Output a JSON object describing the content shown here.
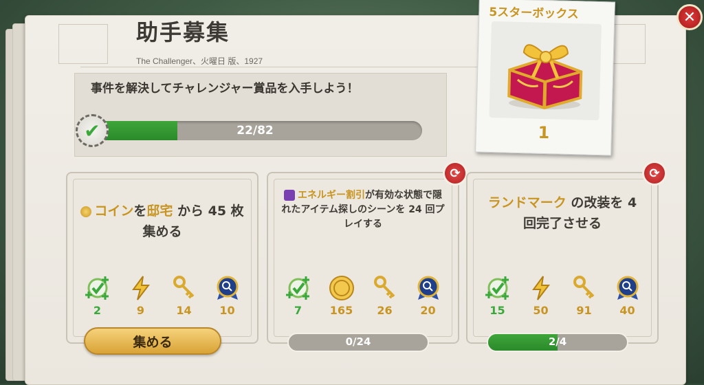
{
  "header": {
    "title": "助手募集",
    "subtitle": "The Challenger、火曜日 版、1927"
  },
  "main_goal": {
    "text": "事件を解決してチャレンジャー賞品を入手しよう！",
    "progress_label": "22/82",
    "current": 22,
    "total": 82
  },
  "reward": {
    "title": "5スターボックス",
    "count": "1"
  },
  "tasks": [
    {
      "segments": [
        {
          "text": "コイン",
          "hl": true
        },
        {
          "text": "を",
          "hl": false
        },
        {
          "text": "邸宅",
          "hl": true
        },
        {
          "text": " から 45 枚集める",
          "hl": false
        }
      ],
      "rewards": [
        {
          "icon": "check-plus-icon",
          "value": "2"
        },
        {
          "icon": "energy-icon",
          "value": "9"
        },
        {
          "icon": "key-icon",
          "value": "14"
        },
        {
          "icon": "magnifier-medal-icon",
          "value": "10"
        }
      ],
      "button_label": "集める"
    },
    {
      "segments": [
        {
          "text": "エネルギー割引",
          "hl": true
        },
        {
          "text": "が有効な状態で隠れたアイテム探しのシーンを 24 回プレイする",
          "hl": false
        }
      ],
      "rewards": [
        {
          "icon": "check-plus-icon",
          "value": "7"
        },
        {
          "icon": "coin-icon",
          "value": "165"
        },
        {
          "icon": "key-icon",
          "value": "26"
        },
        {
          "icon": "magnifier-medal-icon",
          "value": "20"
        }
      ],
      "progress_label": "0/24",
      "progress": 0.0
    },
    {
      "segments": [
        {
          "text": "ランドマーク",
          "hl": true
        },
        {
          "text": " の改装を 4 回完了させる",
          "hl": false
        }
      ],
      "rewards": [
        {
          "icon": "check-plus-icon",
          "value": "15"
        },
        {
          "icon": "energy-icon",
          "value": "50"
        },
        {
          "icon": "key-icon",
          "value": "91"
        },
        {
          "icon": "magnifier-medal-icon",
          "value": "40"
        }
      ],
      "progress_label": "2/4",
      "progress": 0.5
    }
  ],
  "colors": {
    "gold": "#c89422",
    "green": "#3aa83a",
    "red": "#c42a2a"
  }
}
